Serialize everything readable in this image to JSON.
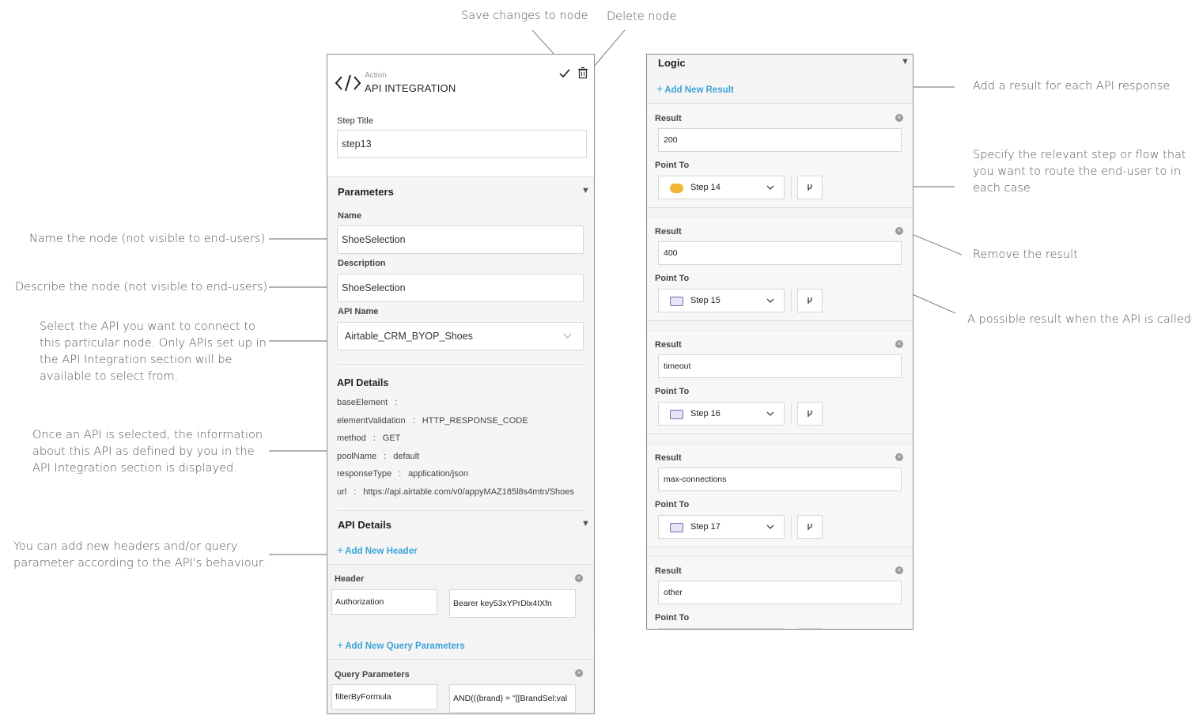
{
  "annotations": {
    "save_changes": "Save changes to node",
    "delete_node": "Delete node",
    "name_node": "Name the node (not visible to end-users)",
    "describe_node": "Describe the node (not visible to end-users)",
    "select_api": [
      "Select the API you want to connect to",
      "this particular node. Only APIs set up in",
      "the API Integration section will be",
      "available to select from."
    ],
    "api_selected": [
      "Once an API is selected, the information",
      "about this API as defined by you in the",
      "API Integration section is displayed."
    ],
    "add_headers": [
      "You can add new headers and/or query",
      "parameter according to the API's behaviour."
    ],
    "add_result": "Add a result for each API response",
    "specify_step": [
      "Specify the relevant step or flow that",
      "you want to route the end-user to in",
      "each case"
    ],
    "remove_result": "Remove the result",
    "possible_result": "A possible result when the API is called"
  },
  "node": {
    "type_label": "Action",
    "title": "API INTEGRATION",
    "step_title_label": "Step Title",
    "step_title_value": "step13"
  },
  "parameters": {
    "section_title": "Parameters",
    "name_label": "Name",
    "name_value": "ShoeSelection",
    "description_label": "Description",
    "description_value": "ShoeSelection",
    "api_name_label": "API Name",
    "api_name_value": "Airtable_CRM_BYOP_Shoes"
  },
  "api_details": {
    "title": "API Details",
    "rows": [
      {
        "key": "baseElement",
        "value": ""
      },
      {
        "key": "elementValidation",
        "value": "HTTP_RESPONSE_CODE"
      },
      {
        "key": "method",
        "value": "GET"
      },
      {
        "key": "poolName",
        "value": "default"
      },
      {
        "key": "responseType",
        "value": "application/json"
      },
      {
        "key": "url",
        "value": "https://api.airtable.com/v0/appyMAZ185l8s4mtn/Shoes"
      }
    ]
  },
  "api_details_section": {
    "title": "API Details",
    "add_header": "Add New Header",
    "header_label": "Header",
    "header_key": "Authorization",
    "header_value": "Bearer key53xYPrDlx4IXfn",
    "add_query": "Add New Query Parameters",
    "query_label": "Query Parameters",
    "query_key": "filterByFormula",
    "query_value": "AND(({brand} = \"[[BrandSel:val"
  },
  "logic": {
    "title": "Logic",
    "add_result": "Add New Result",
    "result_label": "Result",
    "point_to_label": "Point To",
    "results": [
      {
        "value": "200",
        "step": "Step 14",
        "badge": "gold"
      },
      {
        "value": "400",
        "step": "Step 15",
        "badge": "chat"
      },
      {
        "value": "timeout",
        "step": "Step 16",
        "badge": "chat"
      },
      {
        "value": "max-connections",
        "step": "Step 17",
        "badge": "chat"
      },
      {
        "value": "other",
        "step": "",
        "badge": "chat"
      }
    ]
  }
}
